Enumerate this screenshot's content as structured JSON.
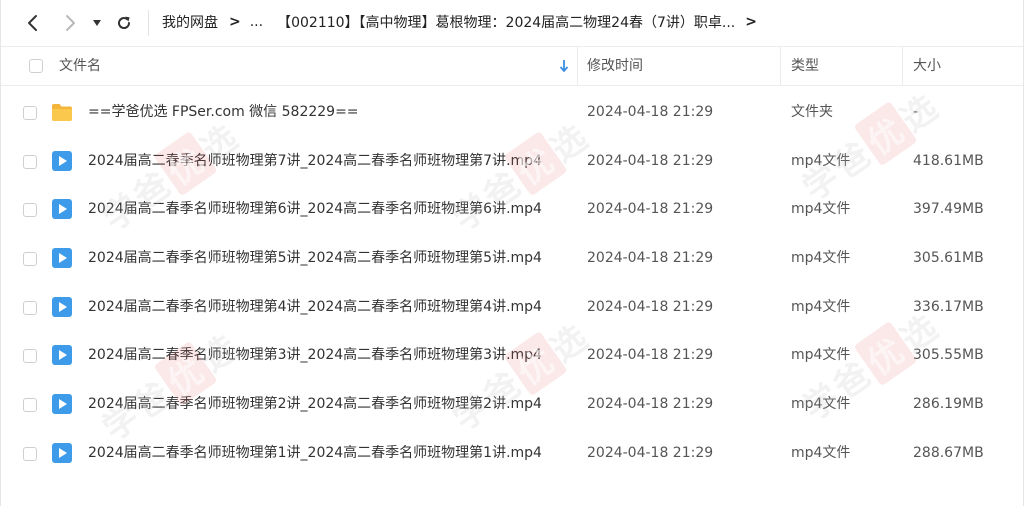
{
  "nav": {
    "back_icon": "chevron-left-icon",
    "forward_icon": "chevron-right-icon",
    "history_icon": "caret-down-icon",
    "refresh_icon": "refresh-icon"
  },
  "breadcrumb": {
    "root": "我的网盘",
    "separator": ">",
    "ellipsis": "...",
    "current": "【002110】【高中物理】葛根物理：2024届高二物理24春（7讲）职卓...",
    "trailing_separator": ">"
  },
  "table": {
    "columns": {
      "name": "文件名",
      "modified": "修改时间",
      "type": "类型",
      "size": "大小"
    },
    "rows": [
      {
        "name": "==学爸优选 FPSer.com 微信 582229==",
        "modified": "2024-04-18 21:29",
        "type": "文件夹",
        "size": "-",
        "icon": "folder-icon"
      },
      {
        "name": "2024届高二春季名师班物理第7讲_2024高二春季名师班物理第7讲.mp4",
        "modified": "2024-04-18 21:29",
        "type": "mp4文件",
        "size": "418.61MB",
        "icon": "video-file-icon"
      },
      {
        "name": "2024届高二春季名师班物理第6讲_2024高二春季名师班物理第6讲.mp4",
        "modified": "2024-04-18 21:29",
        "type": "mp4文件",
        "size": "397.49MB",
        "icon": "video-file-icon"
      },
      {
        "name": "2024届高二春季名师班物理第5讲_2024高二春季名师班物理第5讲.mp4",
        "modified": "2024-04-18 21:29",
        "type": "mp4文件",
        "size": "305.61MB",
        "icon": "video-file-icon"
      },
      {
        "name": "2024届高二春季名师班物理第4讲_2024高二春季名师班物理第4讲.mp4",
        "modified": "2024-04-18 21:29",
        "type": "mp4文件",
        "size": "336.17MB",
        "icon": "video-file-icon"
      },
      {
        "name": "2024届高二春季名师班物理第3讲_2024高二春季名师班物理第3讲.mp4",
        "modified": "2024-04-18 21:29",
        "type": "mp4文件",
        "size": "305.55MB",
        "icon": "video-file-icon"
      },
      {
        "name": "2024届高二春季名师班物理第2讲_2024高二春季名师班物理第2讲.mp4",
        "modified": "2024-04-18 21:29",
        "type": "mp4文件",
        "size": "286.19MB",
        "icon": "video-file-icon"
      },
      {
        "name": "2024届高二春季名师班物理第1讲_2024高二春季名师班物理第1讲.mp4",
        "modified": "2024-04-18 21:29",
        "type": "mp4文件",
        "size": "288.67MB",
        "icon": "video-file-icon"
      }
    ]
  },
  "watermark": {
    "text_a": "学爸",
    "text_b": "优",
    "text_c": "选"
  },
  "colors": {
    "folder": "#f7c34a",
    "video": "#3d9be9",
    "sort_arrow": "#3d8fe0"
  }
}
